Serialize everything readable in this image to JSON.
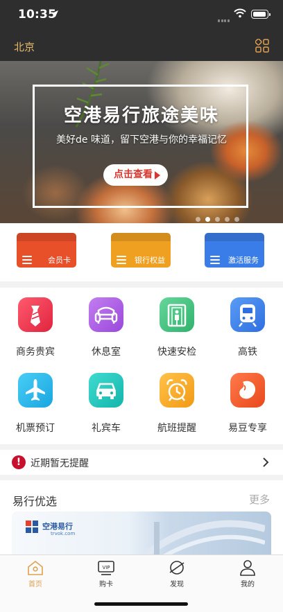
{
  "status_bar": {
    "time": "10:35"
  },
  "header": {
    "city": "北京"
  },
  "banner": {
    "title": "空港易行旅途美味",
    "subtitle": "美好de 味道，留下空港与你的幸福记忆",
    "button_label": "点击查看",
    "dots_total": 5,
    "active_dot": 2
  },
  "cards": [
    {
      "label": "会员卡",
      "color": "#e8502a"
    },
    {
      "label": "银行权益",
      "color": "#f0a020"
    },
    {
      "label": "激活服务",
      "color": "#3a7de8"
    }
  ],
  "services": [
    {
      "label": "商务贵宾",
      "icon": "tie-icon"
    },
    {
      "label": "休息室",
      "icon": "sofa-icon"
    },
    {
      "label": "快速安检",
      "icon": "security-gate-icon"
    },
    {
      "label": "高铁",
      "icon": "train-icon"
    },
    {
      "label": "机票预订",
      "icon": "airplane-icon"
    },
    {
      "label": "礼宾车",
      "icon": "car-icon"
    },
    {
      "label": "航班提醒",
      "icon": "alarm-clock-icon"
    },
    {
      "label": "易豆专享",
      "icon": "bean-icon"
    }
  ],
  "reminder": {
    "text": "近期暂无提醒"
  },
  "preferred": {
    "title": "易行优选",
    "more": "更多",
    "promo_brand": "空港易行",
    "promo_url": "trvok.com"
  },
  "tabs": [
    {
      "label": "首页",
      "icon": "home-icon",
      "active": true
    },
    {
      "label": "购卡",
      "icon": "vip-card-icon",
      "active": false
    },
    {
      "label": "发现",
      "icon": "planet-icon",
      "active": false
    },
    {
      "label": "我的",
      "icon": "person-icon",
      "active": false
    }
  ],
  "colors": {
    "accent": "#e0a050",
    "header_bg": "#2e2e2e",
    "warning": "#c8102e"
  }
}
